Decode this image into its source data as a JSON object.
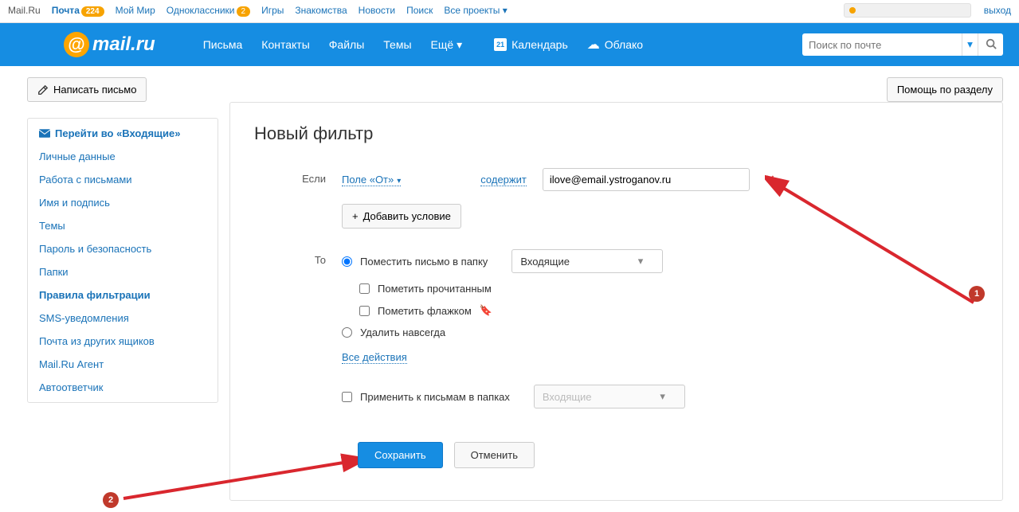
{
  "topbar": {
    "links": [
      {
        "label": "Mail.Ru"
      },
      {
        "label": "Почта",
        "badge": "224"
      },
      {
        "label": "Мой Мир"
      },
      {
        "label": "Одноклассники",
        "badge": "2"
      },
      {
        "label": "Игры"
      },
      {
        "label": "Знакомства"
      },
      {
        "label": "Новости"
      },
      {
        "label": "Поиск"
      },
      {
        "label": "Все проекты",
        "dropdown": true
      }
    ],
    "logout": "выход"
  },
  "mainbar": {
    "logo_text": "mail.ru",
    "nav": [
      "Письма",
      "Контакты",
      "Файлы",
      "Темы",
      "Ещё"
    ],
    "calendar": "Календарь",
    "calendar_day": "21",
    "cloud": "Облако",
    "search_placeholder": "Поиск по почте"
  },
  "left": {
    "compose": "Написать письмо",
    "inbox_link": "Перейти во «Входящие»",
    "items": [
      "Личные данные",
      "Работа с письмами",
      "Имя и подпись",
      "Темы",
      "Пароль и безопасность",
      "Папки",
      "Правила фильтрации",
      "SMS-уведомления",
      "Почта из других ящиков",
      "Mail.Ru Агент",
      "Автоответчик"
    ],
    "active_index": 6
  },
  "main": {
    "help": "Помощь по разделу",
    "title": "Новый фильтр",
    "if_label": "Если",
    "field_from": "Поле «От»",
    "contains": "содержит",
    "email_value": "ilove@email.ystroganov.ru",
    "add_condition": "Добавить условие",
    "then_label": "То",
    "move_to_folder": "Поместить письмо в папку",
    "folder_inbox": "Входящие",
    "mark_read": "Пометить прочитанным",
    "mark_flag": "Пометить флажком",
    "delete_forever": "Удалить навсегда",
    "all_actions": "Все действия",
    "apply_to_folders": "Применить к письмам в папках",
    "folder_disabled": "Входящие",
    "save": "Сохранить",
    "cancel": "Отменить"
  },
  "annotations": {
    "one": "1",
    "two": "2"
  }
}
